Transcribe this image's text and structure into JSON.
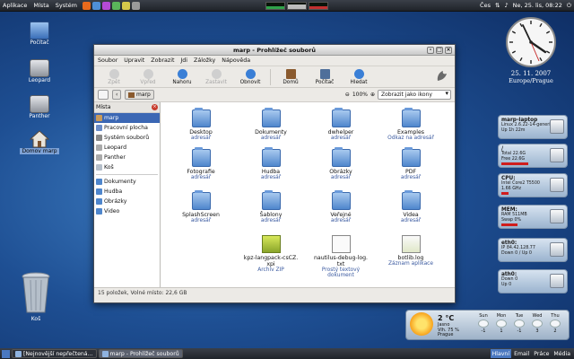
{
  "top_panel": {
    "menu": [
      "Aplikace",
      "Místa",
      "Systém"
    ],
    "lang": "Čes",
    "datetime": "Ne, 25. lis, 08:22"
  },
  "desktop_icons": [
    {
      "label": "Počítač"
    },
    {
      "label": "Leopard"
    },
    {
      "label": "Panther"
    },
    {
      "label": "Domov marp"
    },
    {
      "label": "Koš"
    }
  ],
  "window": {
    "title": "marp - Prohlížeč souborů",
    "menubar": [
      "Soubor",
      "Upravit",
      "Zobrazit",
      "Jdi",
      "Záložky",
      "Nápověda"
    ],
    "toolbar": {
      "back": "Zpět",
      "forward": "Vpřed",
      "up": "Nahoru",
      "stop": "Zastavit",
      "reload": "Obnovit",
      "home": "Domů",
      "computer": "Počítač",
      "search": "Hledat"
    },
    "location": {
      "crumb": "marp",
      "zoom": "100%",
      "view": "Zobrazit jako ikony"
    },
    "sidebar": {
      "header": "Místa",
      "items": [
        {
          "label": "marp",
          "active": true
        },
        {
          "label": "Pracovní plocha"
        },
        {
          "label": "Systém souborů"
        },
        {
          "label": "Leopard"
        },
        {
          "label": "Panther"
        },
        {
          "label": "Koš"
        }
      ],
      "bookmarks": [
        "Dokumenty",
        "Hudba",
        "Obrázky",
        "Video"
      ]
    },
    "files": [
      {
        "name": "Desktop",
        "sub": "adresář",
        "kind": "folder"
      },
      {
        "name": "Dokumenty",
        "sub": "adresář",
        "kind": "folder"
      },
      {
        "name": "dwhelper",
        "sub": "adresář",
        "kind": "folder"
      },
      {
        "name": "Examples",
        "sub": "Odkaz na adresář",
        "kind": "folder"
      },
      {
        "name": "Fotografie",
        "sub": "adresář",
        "kind": "folder"
      },
      {
        "name": "Hudba",
        "sub": "adresář",
        "kind": "folder"
      },
      {
        "name": "Obrázky",
        "sub": "adresář",
        "kind": "folder"
      },
      {
        "name": "PDF",
        "sub": "adresář",
        "kind": "folder"
      },
      {
        "name": "SplashScreen",
        "sub": "adresář",
        "kind": "folder"
      },
      {
        "name": "Šablony",
        "sub": "adresář",
        "kind": "folder"
      },
      {
        "name": "Veřejné",
        "sub": "adresář",
        "kind": "folder"
      },
      {
        "name": "Videa",
        "sub": "adresář",
        "kind": "folder"
      },
      {
        "name": "kpz-langpack-csCZ.xpi",
        "name1": "kpz-langpack-csCZ.",
        "name2": "xpi",
        "sub": "Archiv ZIP",
        "kind": "zip"
      },
      {
        "name": "nautilus-debug-log.txt",
        "name1": "nautilus-debug-log.",
        "name2": "txt",
        "sub": "Prostý textový dokument",
        "sub1": "Prostý textový",
        "sub2": "dokument",
        "kind": "text"
      },
      {
        "name": "botlib.log",
        "sub": "Záznam aplikace",
        "kind": "log"
      }
    ],
    "status": "15 položek, Volné místo: 22,6 GB"
  },
  "clock": {
    "date": "25. 11. 2007",
    "zone": "Europe/Prague"
  },
  "widgets": [
    {
      "title": "marp-laptop",
      "lines": [
        "Linux 2.6.22-14-generic",
        "Up 1h 22m"
      ]
    },
    {
      "title": "/",
      "lines": [
        "Total 22.6G",
        "Free 22.6G"
      ]
    },
    {
      "title": "CPU:",
      "lines": [
        "Intel Core2 T5500",
        "1.66 GHz",
        "8%"
      ]
    },
    {
      "title": "MEM:",
      "lines": [
        "RAM 511MB",
        "Swap 0%"
      ]
    },
    {
      "title": "eth0:",
      "lines": [
        "IP 84.42.128.77",
        "Down 0 / Up 0"
      ]
    },
    {
      "title": "ath0:",
      "lines": [
        "Down 0",
        "Up 0"
      ]
    }
  ],
  "weather": {
    "temp": "2 °C",
    "meta": [
      "Jasno",
      "Vlh. 75 %",
      "Prague"
    ],
    "days": [
      {
        "label": "Sun",
        "temp": "-1"
      },
      {
        "label": "Mon",
        "temp": "1"
      },
      {
        "label": "Tue",
        "temp": "-1"
      },
      {
        "label": "Wed",
        "temp": "3"
      },
      {
        "label": "Thu",
        "temp": "2"
      }
    ]
  },
  "bottom_panel": {
    "tasks": [
      {
        "label": "[Nejnovější nepřečtená...",
        "active": false
      },
      {
        "label": "marp - Prohlížeč souborů",
        "active": true
      }
    ],
    "workspaces": [
      {
        "label": "Hlavní",
        "active": true
      },
      {
        "label": "Email",
        "active": false
      },
      {
        "label": "Práce",
        "active": false
      },
      {
        "label": "Média",
        "active": false
      }
    ]
  },
  "colors": {
    "selection": "#3b67b4",
    "folder": "#4f86cc",
    "panel": "#2c3038",
    "accent_red": "#d01d1d"
  }
}
